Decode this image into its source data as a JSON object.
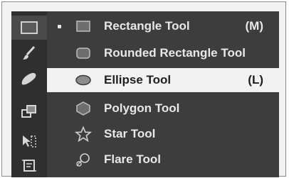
{
  "toolbar": {
    "tools": [
      {
        "icon": "rectangle-tool-icon",
        "active": true
      },
      {
        "icon": "brush-tool-icon"
      },
      {
        "icon": "blob-brush-tool-icon"
      },
      {
        "icon": "shape-builder-tool-icon"
      },
      {
        "icon": "free-transform-tool-icon"
      },
      {
        "icon": "artboard-tool-icon"
      }
    ]
  },
  "flyout": {
    "items": [
      {
        "label": "Rectangle Tool",
        "shortcut": "(M)",
        "icon": "rectangle-icon",
        "selected": true
      },
      {
        "label": "Rounded Rectangle Tool",
        "shortcut": "",
        "icon": "rounded-rectangle-icon"
      },
      {
        "label": "Ellipse Tool",
        "shortcut": "(L)",
        "icon": "ellipse-icon",
        "highlighted": true
      },
      {
        "label": "Polygon Tool",
        "shortcut": "",
        "icon": "polygon-icon"
      },
      {
        "label": "Star Tool",
        "shortcut": "",
        "icon": "star-icon"
      },
      {
        "label": "Flare Tool",
        "shortcut": "",
        "icon": "flare-icon"
      }
    ]
  }
}
